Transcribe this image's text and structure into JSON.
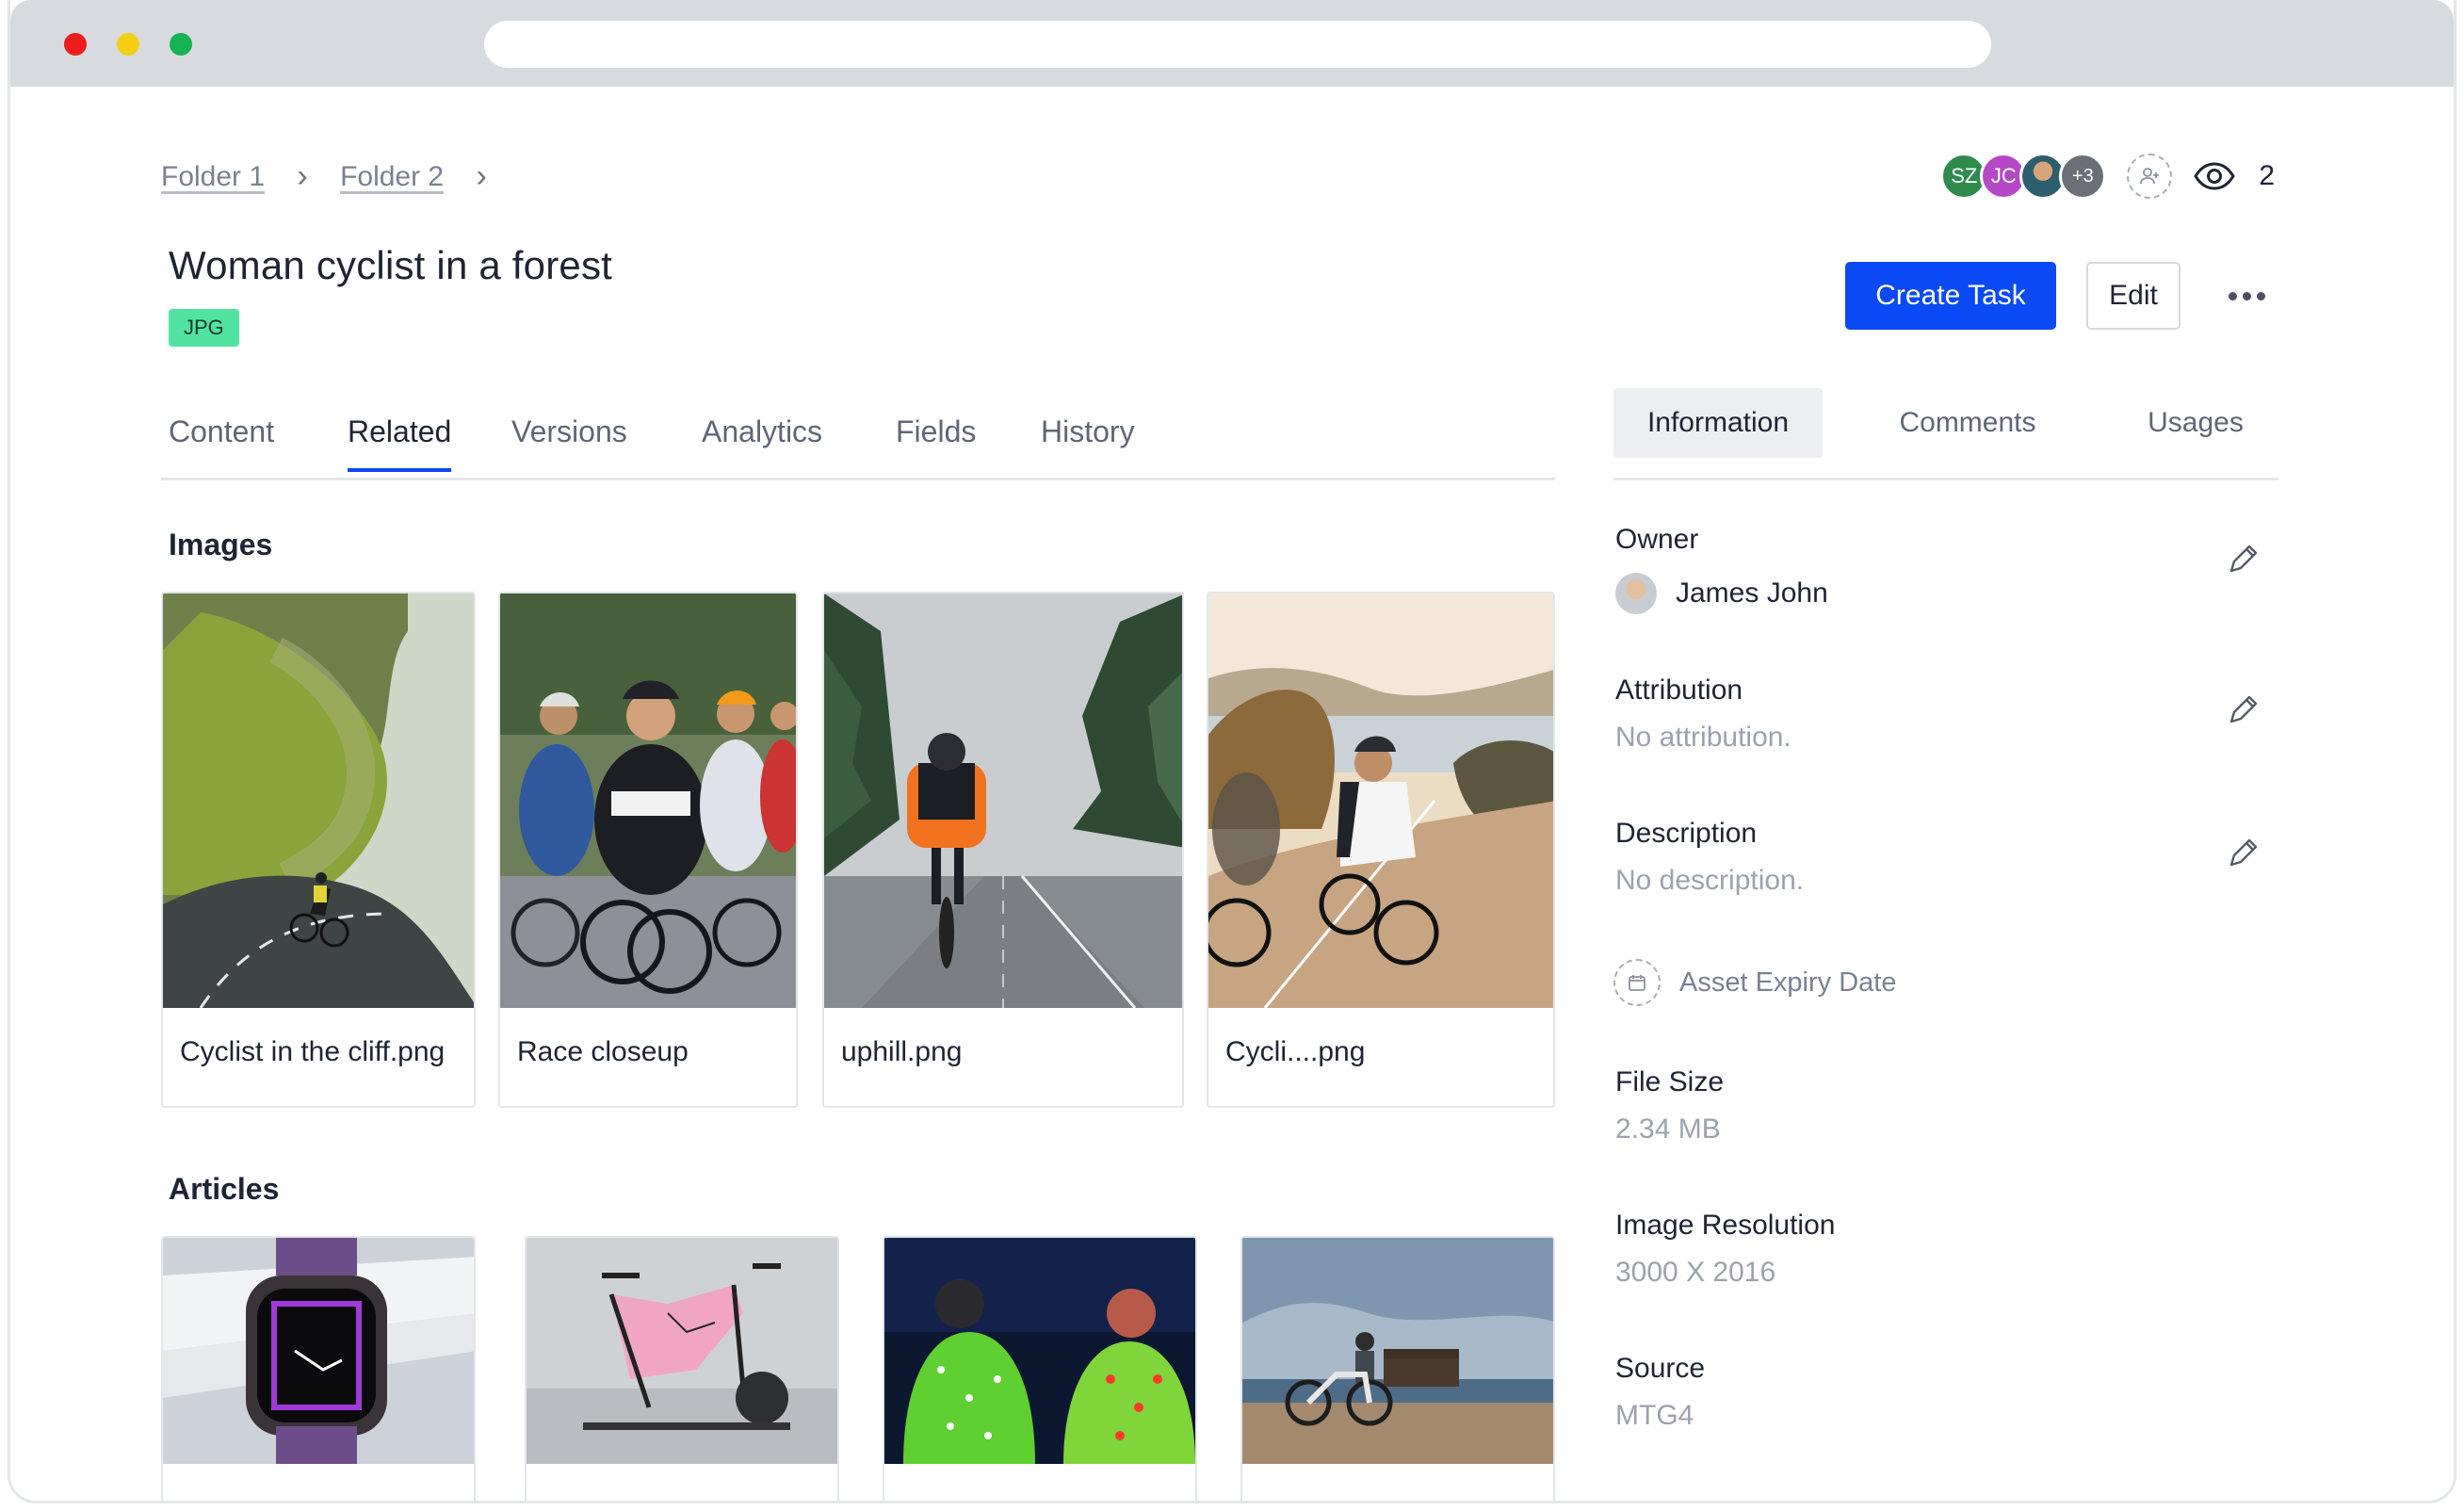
{
  "breadcrumb": {
    "items": [
      "Folder 1",
      "Folder 2"
    ]
  },
  "collaborators": {
    "avatars": [
      "SZ",
      "JC"
    ],
    "more_count": "+3",
    "view_count": "2"
  },
  "asset": {
    "title": "Woman cyclist in a forest",
    "type_badge": "JPG"
  },
  "actions": {
    "create_task": "Create Task",
    "edit": "Edit"
  },
  "tabs": [
    "Content",
    "Related",
    "Versions",
    "Analytics",
    "Fields",
    "History"
  ],
  "active_tab": "Related",
  "sections": {
    "images": "Images",
    "articles": "Articles"
  },
  "images": [
    {
      "caption": "Cyclist in the cliff.png"
    },
    {
      "caption": "Race closeup"
    },
    {
      "caption": "uphill.png"
    },
    {
      "caption": "Cycli....png"
    }
  ],
  "side_tabs": [
    "Information",
    "Comments",
    "Usages"
  ],
  "info": {
    "owner_label": "Owner",
    "owner_name": "James John",
    "attribution_label": "Attribution",
    "attribution_value": "No attribution.",
    "description_label": "Description",
    "description_value": "No description.",
    "expiry_label": "Asset Expiry Date",
    "file_size_label": "File Size",
    "file_size_value": "2.34 MB",
    "resolution_label": "Image Resolution",
    "resolution_value": "3000 X 2016",
    "source_label": "Source",
    "source_value": "MTG4"
  },
  "colors": {
    "primary": "#0a49f4",
    "badge": "#52e3a1"
  }
}
